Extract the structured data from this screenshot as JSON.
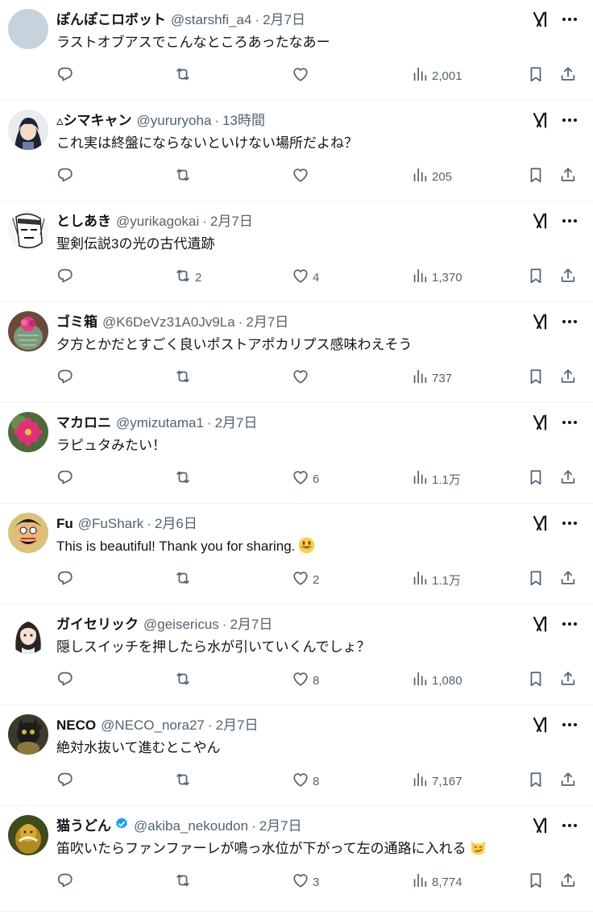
{
  "colors": {
    "text": "#0f1419",
    "secondary": "#536471",
    "divider": "#eff3f4",
    "verified": "#1d9bf0"
  },
  "tweets": [
    {
      "name": "ぽんぽこロボット",
      "handle": "@starshfi_a4",
      "time": "2月7日",
      "text": "ラストオブアスでこんなところあったなあー",
      "replies": "",
      "retweets": "",
      "likes": "",
      "views": "2,001",
      "avatar": "gray"
    },
    {
      "name": "▵シマキャン",
      "handle": "@yururyoha",
      "time": "13時間",
      "text": "これ実は終盤にならないといけない場所だよね？",
      "replies": "",
      "retweets": "",
      "likes": "",
      "views": "205",
      "avatar": "anime-dark"
    },
    {
      "name": "としあき",
      "handle": "@yurikagokai",
      "time": "2月7日",
      "text": "聖剣伝説3の光の古代遺跡",
      "replies": "",
      "retweets": "2",
      "likes": "4",
      "views": "1,370",
      "avatar": "sketch-face"
    },
    {
      "name": "ゴミ箱",
      "handle": "@K6DeVz31A0Jv9La",
      "time": "2月7日",
      "text": "夕方とかだとすごく良いポストアポカリプス感味わえそう",
      "replies": "",
      "retweets": "",
      "likes": "",
      "views": "737",
      "avatar": "cactus"
    },
    {
      "name": "マカロニ",
      "handle": "@ymizutama1",
      "time": "2月7日",
      "text": "ラピュタみたい！",
      "replies": "",
      "retweets": "",
      "likes": "6",
      "views": "1.1万",
      "avatar": "flower"
    },
    {
      "name": "Fu",
      "handle": "@FuShark",
      "time": "2月6日",
      "text": "This is beautiful! Thank you for sharing.",
      "emoji": "grinning-face",
      "replies": "",
      "retweets": "",
      "likes": "2",
      "views": "1.1万",
      "avatar": "cartoon-man"
    },
    {
      "name": "ガイセリック",
      "handle": "@geisericus",
      "time": "2月7日",
      "text": "隠しスイッチを押したら水が引いていくんでしょ？",
      "replies": "",
      "retweets": "",
      "likes": "8",
      "views": "1,080",
      "avatar": "anime-girl"
    },
    {
      "name": "NECO",
      "handle": "@NECO_nora27",
      "time": "2月7日",
      "text": "絶対水抜いて進むとこやん",
      "replies": "",
      "retweets": "",
      "likes": "8",
      "views": "7,167",
      "avatar": "lucky-cat"
    },
    {
      "name": "猫うどん",
      "handle": "@akiba_nekoudon",
      "time": "2月7日",
      "verified": true,
      "text": "笛吹いたらファンファーレが鳴っ水位が下がって左の通路に入れる",
      "emoji": "smirking-cat",
      "replies": "",
      "retweets": "",
      "likes": "3",
      "views": "8,774",
      "avatar": "gold-figure"
    }
  ]
}
